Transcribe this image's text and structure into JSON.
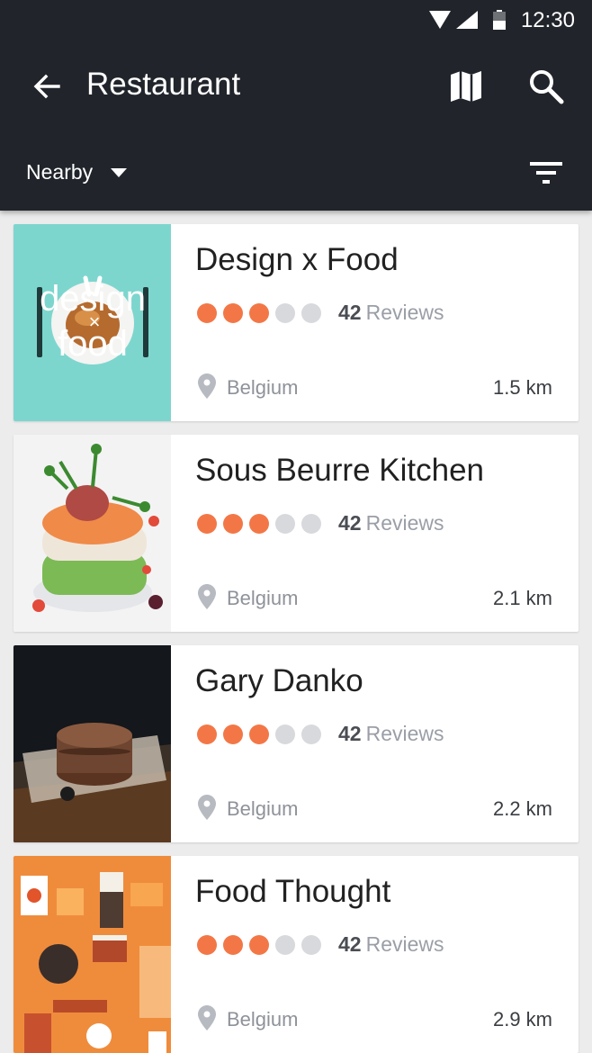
{
  "status_bar": {
    "time": "12:30"
  },
  "app_bar": {
    "title": "Restaurant",
    "back_icon": "arrow-left-icon",
    "map_icon": "map-icon",
    "search_icon": "search-icon",
    "filter": {
      "label": "Nearby",
      "icon": "caret-down-icon"
    },
    "sort_icon": "filter-list-icon",
    "background": "#21252b"
  },
  "colors": {
    "rating_on": "#f37746",
    "rating_off": "#d8d9dd",
    "background": "#ececec"
  },
  "restaurants": [
    {
      "name": "Design x Food",
      "rating": 3,
      "max_rating": 5,
      "review_count": "42",
      "reviews_label": "Reviews",
      "location": "Belgium",
      "distance": "1.5 km",
      "logo_text": [
        "design",
        "×",
        "food"
      ]
    },
    {
      "name": "Sous Beurre Kitchen",
      "rating": 3,
      "max_rating": 5,
      "review_count": "42",
      "reviews_label": "Reviews",
      "location": "Belgium",
      "distance": "2.1 km"
    },
    {
      "name": "Gary Danko",
      "rating": 3,
      "max_rating": 5,
      "review_count": "42",
      "reviews_label": "Reviews",
      "location": "Belgium",
      "distance": "2.2 km"
    },
    {
      "name": "Food Thought",
      "rating": 3,
      "max_rating": 5,
      "review_count": "42",
      "reviews_label": "Reviews",
      "location": "Belgium",
      "distance": "2.9 km"
    }
  ]
}
